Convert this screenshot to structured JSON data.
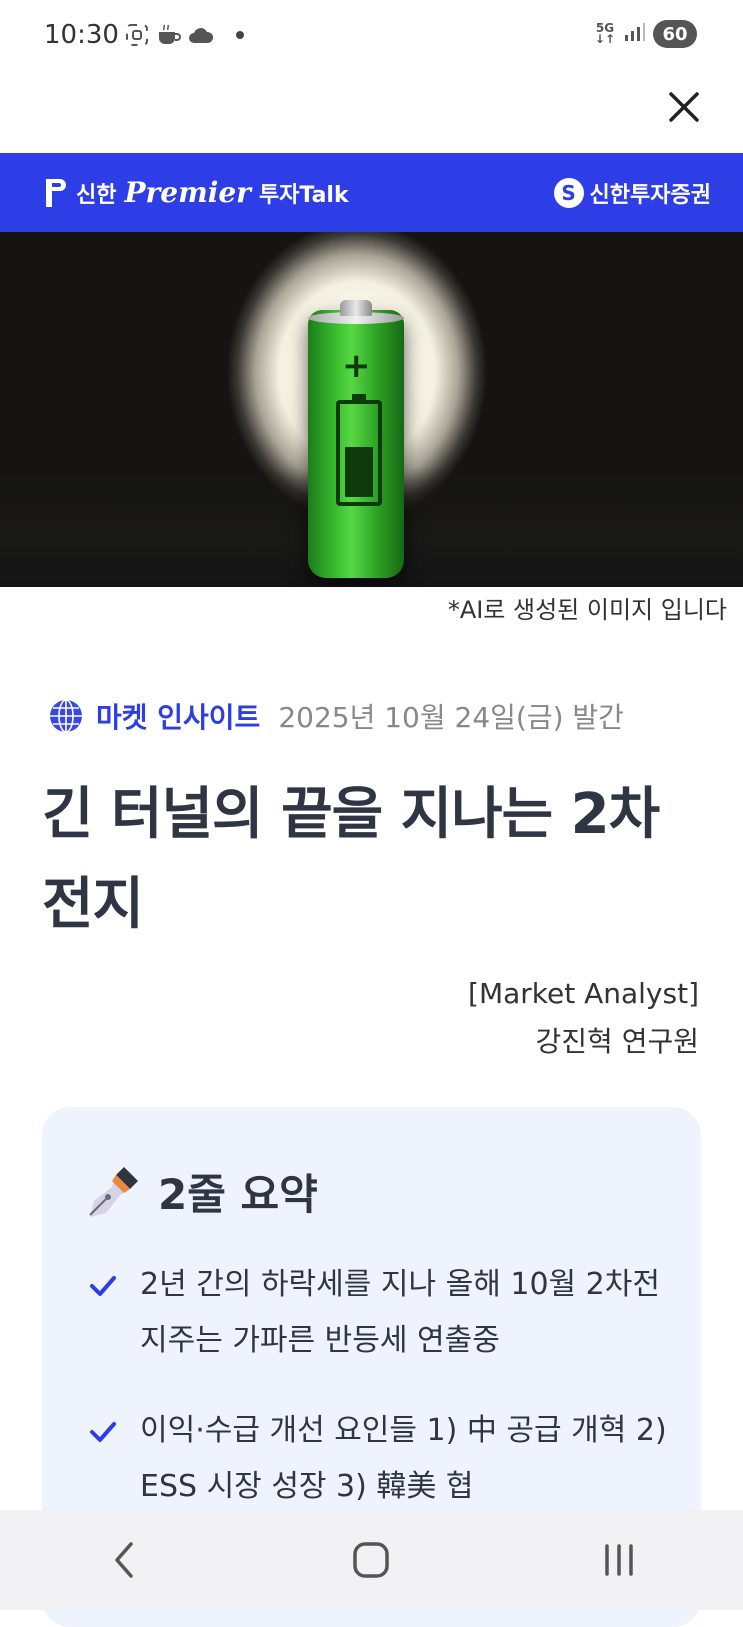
{
  "status_bar": {
    "time": "10:30",
    "network": "5G",
    "battery": "60",
    "icons": [
      "screenshot-icon",
      "coffee-icon",
      "cloud-icon",
      "notification-dot-icon",
      "5g-icon",
      "signal-icon",
      "battery-icon"
    ]
  },
  "header": {
    "brand_shinhan": "신한",
    "brand_premier": "Premier",
    "brand_talk": "투자Talk",
    "company_logo": "S",
    "company_name": "신한투자증권",
    "brand_color": "#2d3ee6"
  },
  "hero": {
    "caption": "*AI로 생성된 이미지 입니다"
  },
  "article": {
    "category": "마켓 인사이트",
    "date": "2025년 10월 24일(금) 발간",
    "title": "긴 터널의 끝을 지나는 2차 전지",
    "author_role": "[Market Analyst]",
    "author_name": "강진혁 연구원"
  },
  "summary": {
    "title": "2줄 요약",
    "items": [
      "2년 간의 하락세를 지나 올해 10월 2차전지주는 가파른 반등세 연출중",
      "이익·수급 개선 요인들 1) 中 공급 개혁 2) ESS 시장 성장 3) 韓美 협"
    ]
  },
  "navigation": [
    "back-button",
    "home-button",
    "recents-button"
  ]
}
